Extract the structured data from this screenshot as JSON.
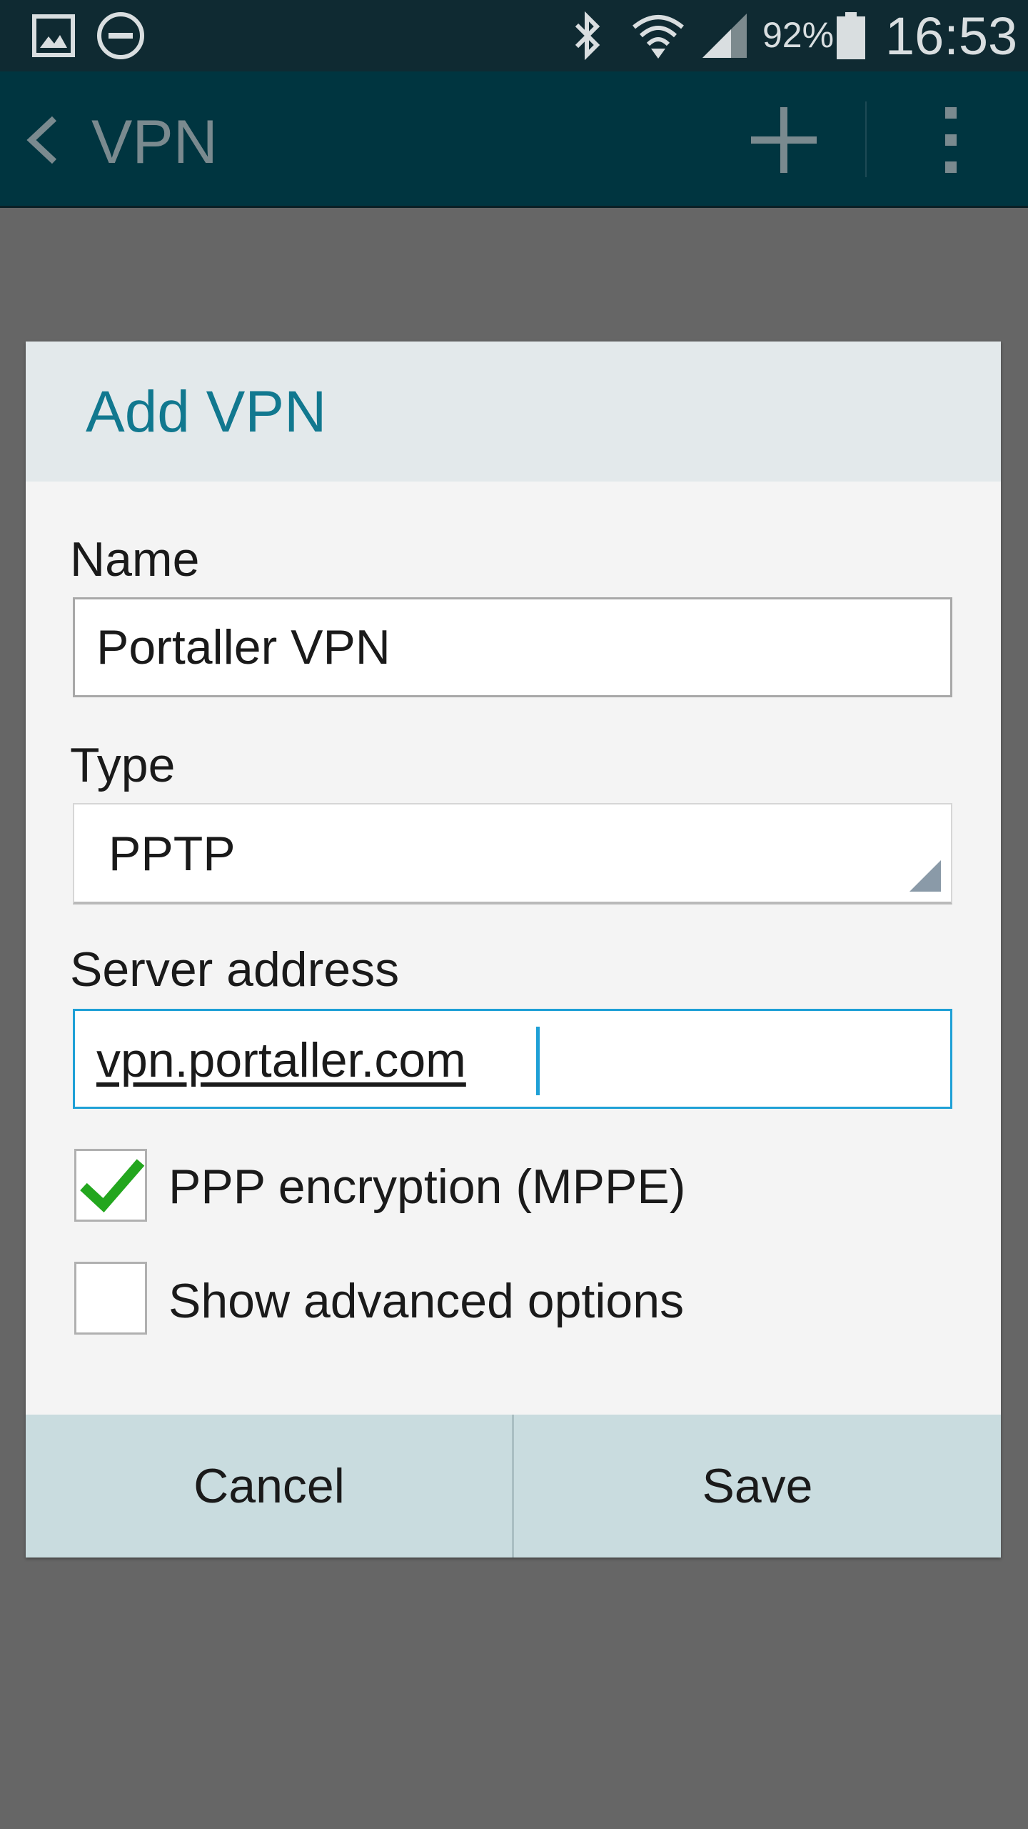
{
  "status_bar": {
    "battery_percent": "92%",
    "time": "16:53",
    "icons": [
      "gallery-icon",
      "do-not-disturb-icon",
      "bluetooth-icon",
      "wifi-icon",
      "signal-icon",
      "battery-icon"
    ]
  },
  "action_bar": {
    "title": "VPN",
    "icons": [
      "back-icon",
      "add-icon",
      "more-options-icon"
    ]
  },
  "dialog": {
    "title": "Add VPN",
    "name_label": "Name",
    "name_value": "Portaller VPN",
    "type_label": "Type",
    "type_value": "PPTP",
    "server_label": "Server address",
    "server_value": "vpn.portaller.com",
    "ppp_encryption_label": "PPP encryption (MPPE)",
    "ppp_encryption_checked": true,
    "advanced_label": "Show advanced options",
    "advanced_checked": false,
    "cancel_label": "Cancel",
    "save_label": "Save"
  },
  "colors": {
    "status_bar": "#0f2a32",
    "action_bar": "#003540",
    "dialog_title": "#11788f",
    "focus_border": "#1ea0d6",
    "check_mark": "#23a61e",
    "footer": "#c9dcdf",
    "scrim": "#666666"
  }
}
